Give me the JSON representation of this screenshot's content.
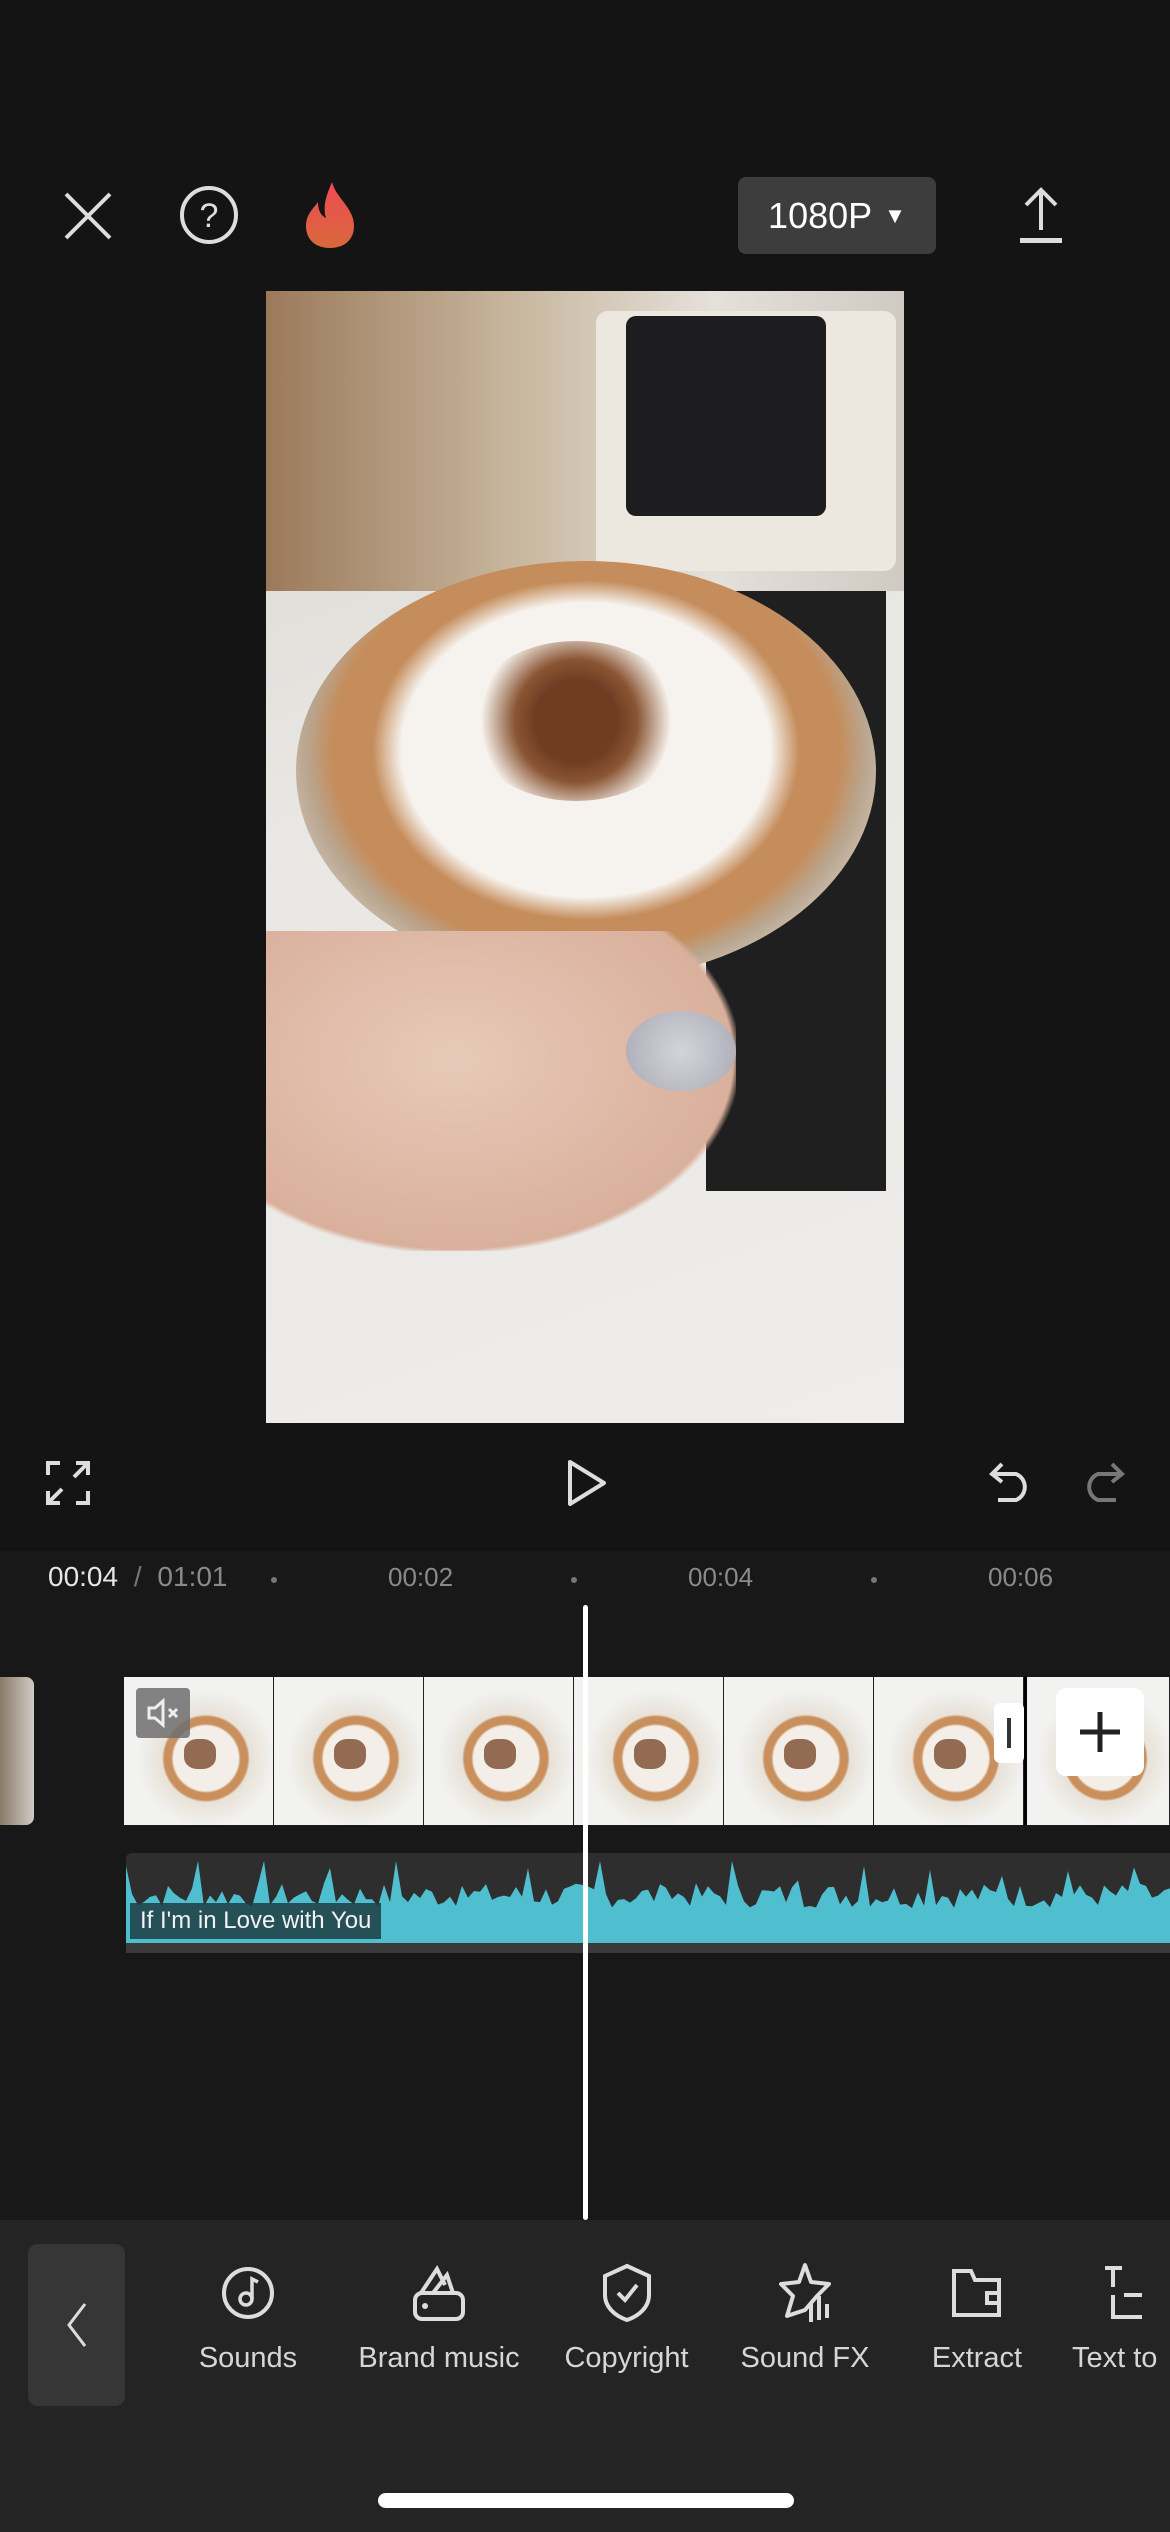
{
  "header": {
    "close_icon": "close-icon",
    "help_icon": "help-icon",
    "flame_icon": "flame-icon",
    "resolution": "1080P",
    "export_icon": "upload-icon",
    "flame_color": "#e8574a"
  },
  "player": {
    "fullscreen_icon": "fullscreen-icon",
    "play_icon": "play-icon",
    "undo_icon": "undo-icon",
    "redo_icon": "redo-icon"
  },
  "timeline": {
    "current_time": "00:04",
    "separator": "/",
    "total_time": "01:01",
    "ticks": [
      "00:02",
      "00:04",
      "00:06"
    ],
    "audio_track_title": "If I'm in Love with You",
    "waveform_color": "#4fbfcf",
    "mute_icon": "mute-icon",
    "add_icon": "plus-icon"
  },
  "toolbar": {
    "back_icon": "chevron-left-icon",
    "items": [
      {
        "label": "Sounds",
        "icon": "music-disc-icon"
      },
      {
        "label": "Brand music",
        "icon": "brand-music-icon"
      },
      {
        "label": "Copyright",
        "icon": "shield-check-icon"
      },
      {
        "label": "Sound FX",
        "icon": "star-sound-icon"
      },
      {
        "label": "Extract",
        "icon": "folder-icon"
      },
      {
        "label": "Text to",
        "icon": "text-to-audio-icon"
      }
    ]
  }
}
